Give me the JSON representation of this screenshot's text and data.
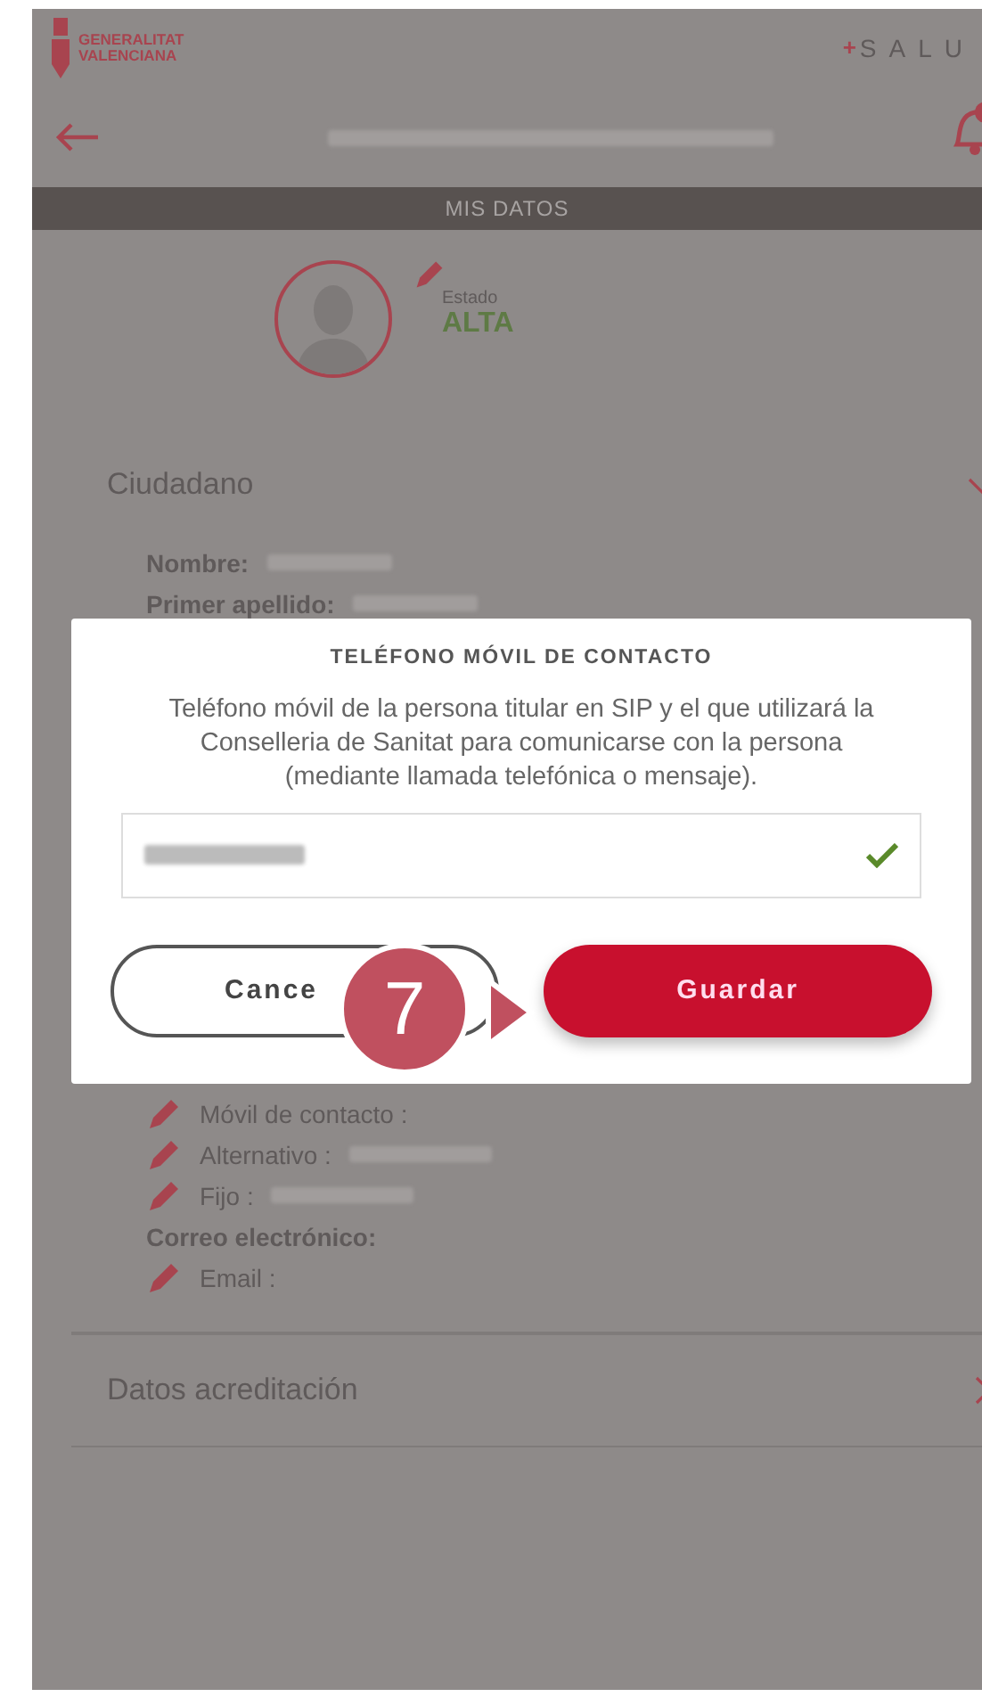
{
  "header": {
    "logo_lines": [
      "GENERALITAT",
      "VALENCIANA"
    ],
    "brand": "SALU",
    "brand_mark": "+"
  },
  "nav": {
    "title_hidden": true
  },
  "section_bar": "MIS DATOS",
  "profile": {
    "status_label": "Estado",
    "status": "ALTA"
  },
  "sections": [
    {
      "title": "Ciudadano",
      "expanded": true,
      "items": [
        {
          "kind": "field",
          "label": "Nombre:",
          "value_hidden": true
        },
        {
          "kind": "field",
          "label": "Primer apellido:",
          "value_hidden": true
        },
        {
          "kind": "spacer"
        },
        {
          "kind": "editable",
          "label": "Móvil de contacto :",
          "value_hidden": false
        },
        {
          "kind": "editable",
          "label": "Alternativo :",
          "value_hidden": true
        },
        {
          "kind": "editable",
          "label": "Fijo :",
          "value_hidden": true
        },
        {
          "kind": "heading",
          "label": "Correo electrónico:"
        },
        {
          "kind": "editable",
          "label": "Email :",
          "value_hidden": false
        }
      ]
    },
    {
      "title": "Datos acreditación",
      "expanded": false
    }
  ],
  "modal": {
    "title": "TELÉFONO MÓVIL DE CONTACTO",
    "description": "Teléfono móvil de la persona titular en SIP y el que utilizará la Conselleria de Sanitat para comunicarse con la persona (mediante llamada telefónica o mensaje).",
    "input": {
      "value_hidden": true,
      "valid": true
    },
    "buttons": [
      {
        "label": "Cance",
        "kind": "secondary"
      },
      {
        "label": "Guardar",
        "kind": "primary"
      }
    ]
  },
  "step_marker": "7"
}
